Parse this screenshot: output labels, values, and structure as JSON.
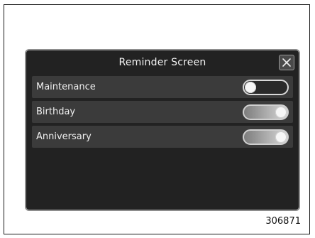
{
  "screen": {
    "title": "Reminder Screen",
    "close_icon": "close-icon"
  },
  "reminders": [
    {
      "label": "Maintenance",
      "state": "off",
      "toggle_value": 0
    },
    {
      "label": "Birthday",
      "state": "on",
      "toggle_value": 1
    },
    {
      "label": "Anniversary",
      "state": "on",
      "toggle_value": 1
    }
  ],
  "figure": {
    "id": "306871"
  },
  "colors": {
    "screen_bg": "#222222",
    "row_bg": "#3b3b3b",
    "text_light": "#f0f0f0"
  }
}
